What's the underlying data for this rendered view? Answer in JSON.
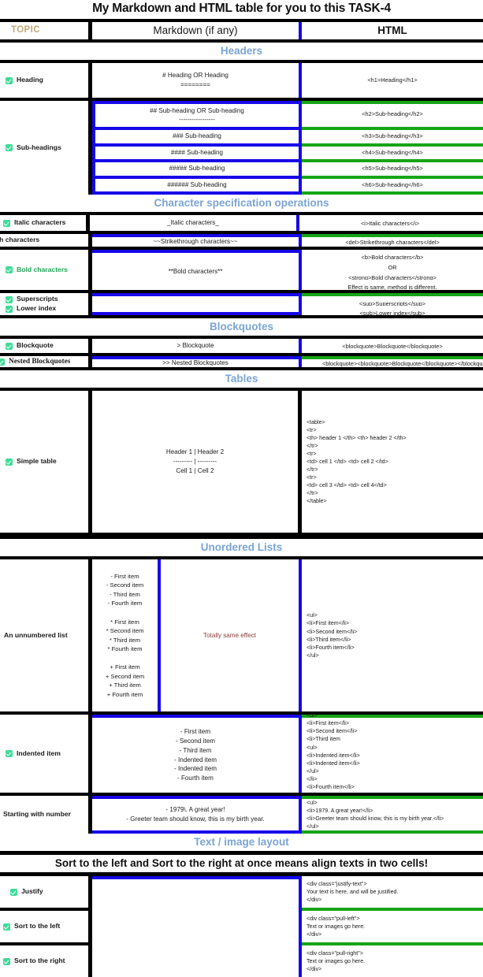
{
  "title": "My Markdown and HTML table for you to this TASK-4",
  "colors": {
    "accent_blue": "#1707e8",
    "accent_green": "#16a417",
    "section_heading": "#7aa4d6",
    "topic_gold": "#c4a875",
    "checkbox_green": "#3ddc97",
    "note_red": "#8d3a3a"
  },
  "header": {
    "topic": "TOPIC",
    "markdown": "Markdown (if any)",
    "html": "HTML"
  },
  "sections": {
    "headers": "Headers",
    "character_spec": "Character specification operations",
    "blockquotes": "Blockquotes",
    "tables": "Tables",
    "unordered_lists": "Unordered Lists",
    "text_image_layout": "Text / image layout"
  },
  "note_band": "Sort to the left and Sort to the right at once means align texts in two cells!",
  "rows": {
    "heading": {
      "topic": "Heading",
      "markdown": "# Heading OR Heading\n========",
      "html": "<h1>Heading</h1>"
    },
    "subheadings": {
      "topic": "Sub-headings",
      "lines": [
        {
          "markdown": "## Sub-heading OR Sub-heading\n-----------------",
          "html": "<h2>Sub-heading</h2>"
        },
        {
          "markdown": "### Sub-heading",
          "html": "<h3>Sub-heading</h3>"
        },
        {
          "markdown": "#### Sub-heading",
          "html": "<h4>Sub-heading</h4>"
        },
        {
          "markdown": "##### Sub-heading",
          "html": "<h5>Sub-heading</h5>"
        },
        {
          "markdown": "###### Sub-heading",
          "html": "<h6>Sub-heading</h6>"
        }
      ]
    },
    "italic": {
      "topic": "Italic characters",
      "markdown": "_Italic characters_",
      "html": "<i>Italic characters</i>"
    },
    "strikethrough": {
      "topic": "Strikethrough characters",
      "markdown": "~~Strikethrough characters~~",
      "html": "<del>Strikethrough characters</del>"
    },
    "bold": {
      "topic": "Bold characters",
      "markdown": "**Bold characters**",
      "html_lines": [
        "<b>Bold characters</b>",
        "OR",
        "<strong>Bold characters</strong>",
        "Effect is same, method is different."
      ]
    },
    "superscripts": {
      "topic": "Superscripts",
      "markdown": "",
      "html": "<sup>Superscripts</sup>"
    },
    "lower_index": {
      "topic": "Lower index",
      "markdown": "",
      "html": "<sub>Lower index</sub>"
    },
    "blockquote": {
      "topic": "Blockquote",
      "markdown": "> Blockquote",
      "html": "<blockquote>Blockquote</blockquote>"
    },
    "nested_blockquotes": {
      "topic": "Nested Blockquotes",
      "markdown": ">> Nested Blockquotes",
      "html": "<blockquote><blockquote>Blockquote</blockquote></blockquote>"
    },
    "simple_table": {
      "topic": "Simple table",
      "markdown": "Header 1 | Header 2\n--------- | ---------\nCell 1 | Cell 2",
      "html": "<table>\n<tr>\n<th> header 1 </th> <th> header 2 </th>\n</tr>\n<tr>\n<td> cell 1 </td> <td> cell 2 </td>\n</tr>\n<tr>\n<td> cell 3 </td> <td> cell 4</td>\n</tr>\n</table>"
    },
    "unnumbered_list": {
      "topic": "An unnumbered list",
      "markdown": "- First item\n- Second item\n- Third item\n- Fourth item\n\n* First item\n* Second item\n* Third item\n* Fourth item\n\n+ First item\n+ Second item\n+ Third item\n+ Fourth item",
      "middle_note": "Totally same effect",
      "html": "<ul>\n<li>First item</li>\n<li>Second item</li>\n<li>Third item</li>\n<li>Fourth item</li>\n</ul>"
    },
    "indented_item": {
      "topic": "Indented item",
      "markdown": "- First item\n- Second item\n- Third item\n- Indented item\n- Indented item\n- Fourth item",
      "html": "<ul>\n<li>First item</li>\n<li>Second item</li>\n<li>Third item\n<ul>\n<li>Indented item</li>\n<li>Indented item</li>\n</ul>\n</li>\n<li>Fourth item</li>\n</ul>"
    },
    "starting_with_number": {
      "topic": "Starting with number",
      "markdown": "- 1979\\. A great year!\n- Greeter team should know, this is my birth year.",
      "html": "<ul>\n<li>1979. A great year!</li>\n<li>Greeter team should know, this is my birth year.</li>\n</ul>"
    },
    "justify": {
      "topic": "Justify",
      "markdown": "",
      "html": "<div class=\"justify-text\">\nYour text is here, and will be justified.\n</div>"
    },
    "sort_left": {
      "topic": "Sort to the left",
      "markdown": "",
      "html": "<div class=\"pull-left\">\nText or images go here.\n</div>"
    },
    "sort_right": {
      "topic": "Sort to the right",
      "markdown": "",
      "html": "<div class=\"pull-right\">\nText or images go here.\n</div>"
    }
  }
}
